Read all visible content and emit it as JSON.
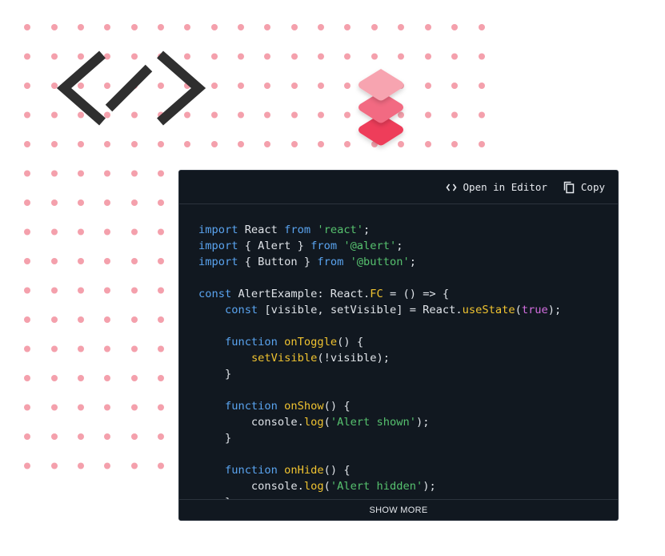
{
  "decor": {
    "dot_color": "#f4a0ac",
    "code_logo_color": "#2f2f2f",
    "stack_layer_colors": [
      "#f7a4b0",
      "#f26b82",
      "#ee3c5a"
    ]
  },
  "toolbar": {
    "open_in_editor_label": "Open in Editor",
    "open_in_editor_icon": "code-brackets-icon",
    "copy_label": "Copy",
    "copy_icon": "copy-icon"
  },
  "code_lines": [
    [
      [
        "kw",
        "import"
      ],
      [
        "p",
        " React "
      ],
      [
        "kw",
        "from"
      ],
      [
        "p",
        " "
      ],
      [
        "str",
        "'react'"
      ],
      [
        "p",
        ";"
      ]
    ],
    [
      [
        "kw",
        "import"
      ],
      [
        "p",
        " { Alert } "
      ],
      [
        "kw",
        "from"
      ],
      [
        "p",
        " "
      ],
      [
        "str",
        "'@alert'"
      ],
      [
        "p",
        ";"
      ]
    ],
    [
      [
        "kw",
        "import"
      ],
      [
        "p",
        " { Button } "
      ],
      [
        "kw",
        "from"
      ],
      [
        "p",
        " "
      ],
      [
        "str",
        "'@button'"
      ],
      [
        "p",
        ";"
      ]
    ],
    [],
    [
      [
        "kw",
        "const"
      ],
      [
        "p",
        " AlertExample: React."
      ],
      [
        "fn",
        "FC"
      ],
      [
        "p",
        " = () => {"
      ]
    ],
    [
      [
        "p",
        "    "
      ],
      [
        "kw",
        "const"
      ],
      [
        "p",
        " [visible, setVisible] = React."
      ],
      [
        "fn",
        "useState"
      ],
      [
        "p",
        "("
      ],
      [
        "bool",
        "true"
      ],
      [
        "p",
        ");"
      ]
    ],
    [],
    [
      [
        "p",
        "    "
      ],
      [
        "kw",
        "function"
      ],
      [
        "p",
        " "
      ],
      [
        "fn",
        "onToggle"
      ],
      [
        "p",
        "() {"
      ]
    ],
    [
      [
        "p",
        "        "
      ],
      [
        "fn",
        "setVisible"
      ],
      [
        "p",
        "(!visible);"
      ]
    ],
    [
      [
        "p",
        "    }"
      ]
    ],
    [],
    [
      [
        "p",
        "    "
      ],
      [
        "kw",
        "function"
      ],
      [
        "p",
        " "
      ],
      [
        "fn",
        "onShow"
      ],
      [
        "p",
        "() {"
      ]
    ],
    [
      [
        "p",
        "        console."
      ],
      [
        "fn",
        "log"
      ],
      [
        "p",
        "("
      ],
      [
        "str",
        "'Alert shown'"
      ],
      [
        "p",
        ");"
      ]
    ],
    [
      [
        "p",
        "    }"
      ]
    ],
    [],
    [
      [
        "p",
        "    "
      ],
      [
        "kw",
        "function"
      ],
      [
        "p",
        " "
      ],
      [
        "fn",
        "onHide"
      ],
      [
        "p",
        "() {"
      ]
    ],
    [
      [
        "p",
        "        console."
      ],
      [
        "fn",
        "log"
      ],
      [
        "p",
        "("
      ],
      [
        "str",
        "'Alert hidden'"
      ],
      [
        "p",
        ");"
      ]
    ],
    [
      [
        "p",
        "    }"
      ]
    ]
  ],
  "footer": {
    "show_more_label": "SHOW MORE"
  }
}
